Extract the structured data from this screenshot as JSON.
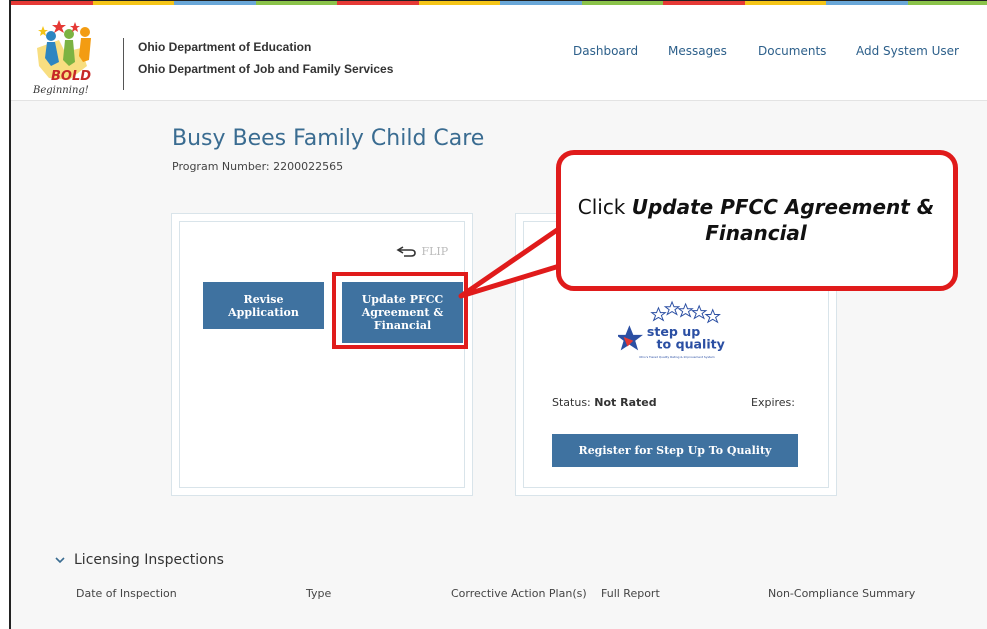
{
  "header": {
    "org_primary": "Ohio Department of Education",
    "org_secondary": "Ohio Department of Job and Family Services",
    "logo_text_bold": "BOLD",
    "logo_text_sub": "Beginning!",
    "nav": [
      {
        "label": "Dashboard"
      },
      {
        "label": "Messages"
      },
      {
        "label": "Documents"
      },
      {
        "label": "Add System User"
      }
    ]
  },
  "program": {
    "name": "Busy Bees Family Child Care",
    "number": "Program Number: 2200022565"
  },
  "left_card": {
    "flip_label": "FLIP",
    "revise_button": "Revise Application",
    "update_button": "Update PFCC Agreement & Financial"
  },
  "right_card": {
    "logo_line1": "step up",
    "logo_line2": "to quality",
    "logo_tagline": "Ohio's Tiered Quality Rating & Improvement System",
    "status_prefix": "Status:",
    "status_value": "Not Rated",
    "expires_label": "Expires:",
    "register_button": "Register for Step Up To Quality"
  },
  "callout": {
    "prefix": "Click ",
    "emphasis": "Update PFCC Agreement & Financial"
  },
  "inspections": {
    "title": "Licensing Inspections",
    "columns": [
      "Date of Inspection",
      "Type",
      "Corrective Action Plan(s)",
      "Full Report",
      "Non-Compliance Summary"
    ]
  },
  "colors": {
    "primary_button": "#3f72a0",
    "title_blue": "#3a6c91",
    "nav_link": "#2c5f8a",
    "highlight_red": "#e01b1b",
    "stripe": [
      "#e53935",
      "#f5c518",
      "#6aa7d8",
      "#8bc34a",
      "#e53935",
      "#f5c518",
      "#6aa7d8",
      "#8bc34a",
      "#e53935",
      "#f5c518",
      "#6aa7d8",
      "#8bc34a"
    ]
  }
}
